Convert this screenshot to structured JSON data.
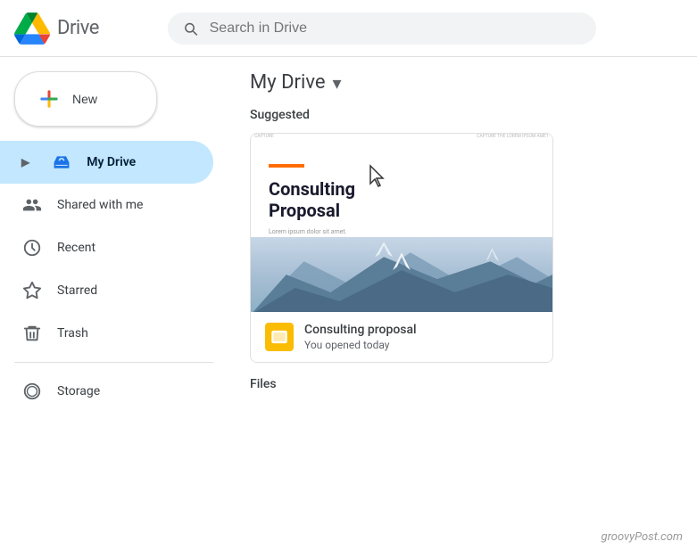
{
  "header": {
    "logo_text": "Drive",
    "search_placeholder": "Search in Drive"
  },
  "new_button": {
    "label": "New"
  },
  "sidebar": {
    "items": [
      {
        "id": "my-drive",
        "label": "My Drive",
        "active": true
      },
      {
        "id": "shared",
        "label": "Shared with me",
        "active": false
      },
      {
        "id": "recent",
        "label": "Recent",
        "active": false
      },
      {
        "id": "starred",
        "label": "Starred",
        "active": false
      },
      {
        "id": "trash",
        "label": "Trash",
        "active": false
      },
      {
        "id": "storage",
        "label": "Storage",
        "active": false
      }
    ]
  },
  "main": {
    "title": "My Drive",
    "sections": {
      "suggested_label": "Suggested",
      "files_label": "Files"
    },
    "suggested_file": {
      "name": "Consulting proposal",
      "meta": "You opened today",
      "doc_title": "Consulting\nProposal",
      "doc_body": "Lorem ipsum dolor sit amet.",
      "header_left": "CAPTURE",
      "header_right": "CAPTURE THE LOREM IPSUM AMET"
    }
  },
  "watermark": "groovyPost.com"
}
